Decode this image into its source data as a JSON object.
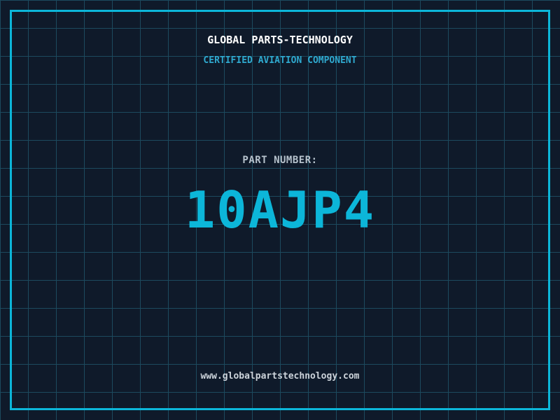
{
  "header": {
    "title": "GLOBAL PARTS-TECHNOLOGY",
    "subtitle": "CERTIFIED AVIATION COMPONENT"
  },
  "part": {
    "label": "PART NUMBER:",
    "number": "10AJP4"
  },
  "footer": {
    "website": "www.globalpartstechnology.com"
  },
  "colors": {
    "background": "#0f1a2a",
    "grid_line": "#1c4a5e",
    "frame_accent": "#0cb6d9",
    "title_text": "#ffffff",
    "subtitle_text": "#2fa9cf",
    "label_text": "#b6c2cc",
    "part_number_text": "#0cb6d9",
    "footer_text": "#ccd3da"
  }
}
